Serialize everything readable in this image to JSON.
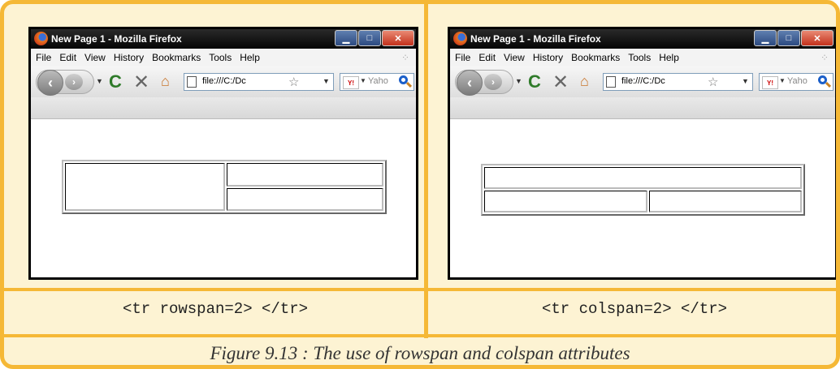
{
  "window_title": "New Page 1 - Mozilla Firefox",
  "menu": [
    "File",
    "Edit",
    "View",
    "History",
    "Bookmarks",
    "Tools",
    "Help"
  ],
  "url": "file:///C:/Dc",
  "search_placeholder": "Yaho",
  "yahoo_icon_label": "Y!",
  "window_buttons": [
    "minimize-icon",
    "maximize-icon",
    "close-icon"
  ],
  "left": {
    "code": "<tr rowspan=2> </tr>"
  },
  "right": {
    "code": "<tr colspan=2> </tr>"
  },
  "caption": "Figure 9.13 : The use of rowspan and colspan attributes",
  "colors": {
    "border": "#f5b836",
    "background": "#fdf3d3"
  }
}
